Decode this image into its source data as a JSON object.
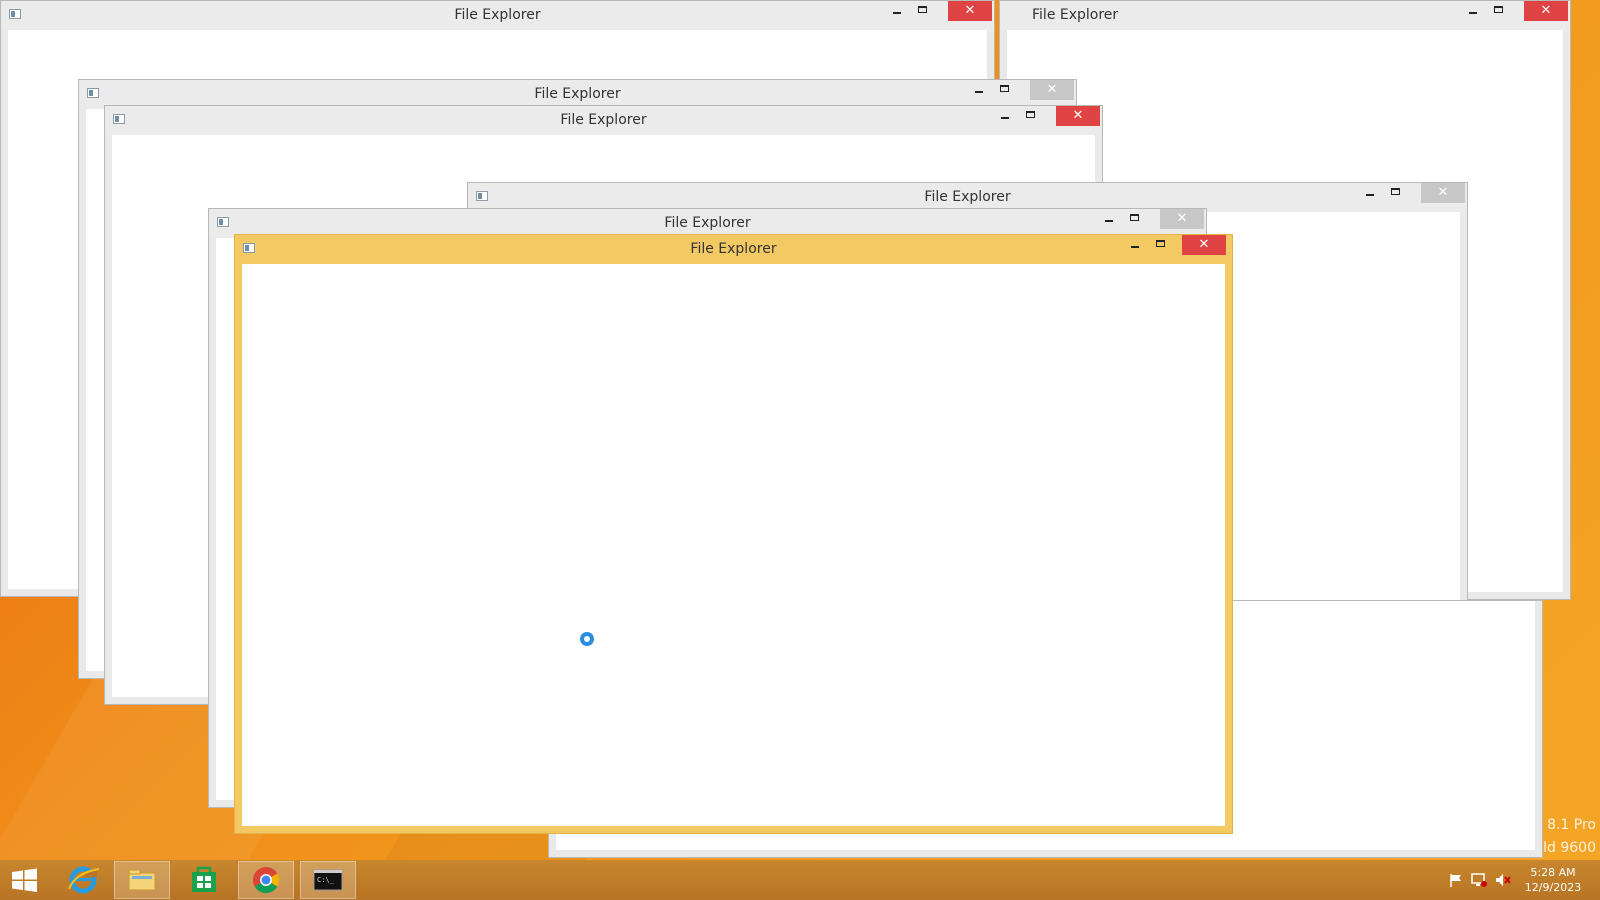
{
  "windows": [
    {
      "title": "File Explorer"
    },
    {
      "title": "File Explorer"
    },
    {
      "title": "File Explorer"
    },
    {
      "title": "File Explorer"
    },
    {
      "title": "File Explorer"
    },
    {
      "title": "File Explorer"
    },
    {
      "title": "File Explorer"
    }
  ],
  "window_controls": {
    "minimize": "–",
    "maximize": "□",
    "close": "✕"
  },
  "taskbar": {
    "start_icon": "windows-start-icon",
    "pinned": [
      {
        "icon": "internet-explorer-icon"
      },
      {
        "icon": "file-explorer-icon"
      },
      {
        "icon": "store-icon"
      },
      {
        "icon": "chrome-icon"
      },
      {
        "icon": "command-prompt-icon"
      }
    ],
    "clock_time": "5:28 AM",
    "clock_date": "12/9/2023"
  },
  "watermark": {
    "line1": "8.1 Pro",
    "line2": "ld 9600"
  },
  "colors": {
    "active_frame": "#f3c963",
    "close_red": "#e04343",
    "spinner": "#2a8de0"
  }
}
